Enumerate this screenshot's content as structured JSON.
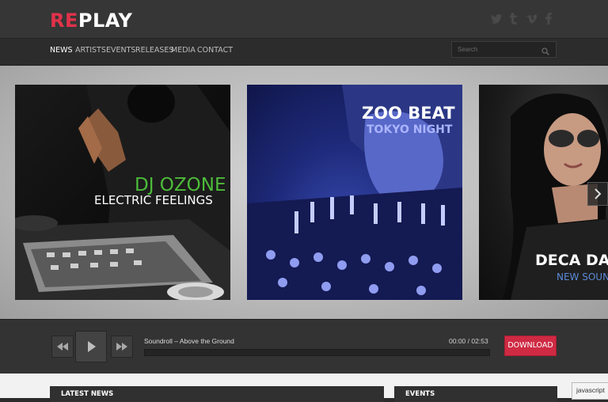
{
  "brand": {
    "re": "RE",
    "play": "PLAY"
  },
  "social": [
    {
      "name": "twitter",
      "glyph": "t"
    },
    {
      "name": "tumblr",
      "glyph": "t"
    },
    {
      "name": "vimeo",
      "glyph": "v"
    },
    {
      "name": "facebook",
      "glyph": "f"
    }
  ],
  "nav": {
    "items": [
      "NEWS",
      "ARTISTS",
      "EVENTS",
      "RELEASES",
      "MEDIA",
      "CONTACT"
    ],
    "active": "NEWS"
  },
  "search": {
    "placeholder": "Search"
  },
  "slides": [
    {
      "title": "DJ OZONE",
      "subtitle": "ELECTRIC FEELINGS",
      "title_color": "#4dbb3a",
      "subtitle_color": "#ffffff"
    },
    {
      "title": "ZOO BEAT",
      "subtitle": "TOKYO NIGHT",
      "title_color": "#ffffff",
      "subtitle_color": "#aab4ff"
    },
    {
      "title": "DECA DA",
      "subtitle": "NEW SOUN",
      "title_color": "#ffffff",
      "subtitle_color": "#5b8ad8"
    }
  ],
  "player": {
    "track": "Soundroll – Above the Ground",
    "current_time": "00:00",
    "separator": "/",
    "duration": "02:53",
    "progress": 0,
    "download_label": "DOWNLOAD"
  },
  "sections": {
    "latest_news": "LATEST NEWS",
    "events": "EVENTS"
  },
  "status_bar": "javascript",
  "colors": {
    "accent": "#e0324a",
    "download": "#cf2a43",
    "header": "#363636"
  }
}
